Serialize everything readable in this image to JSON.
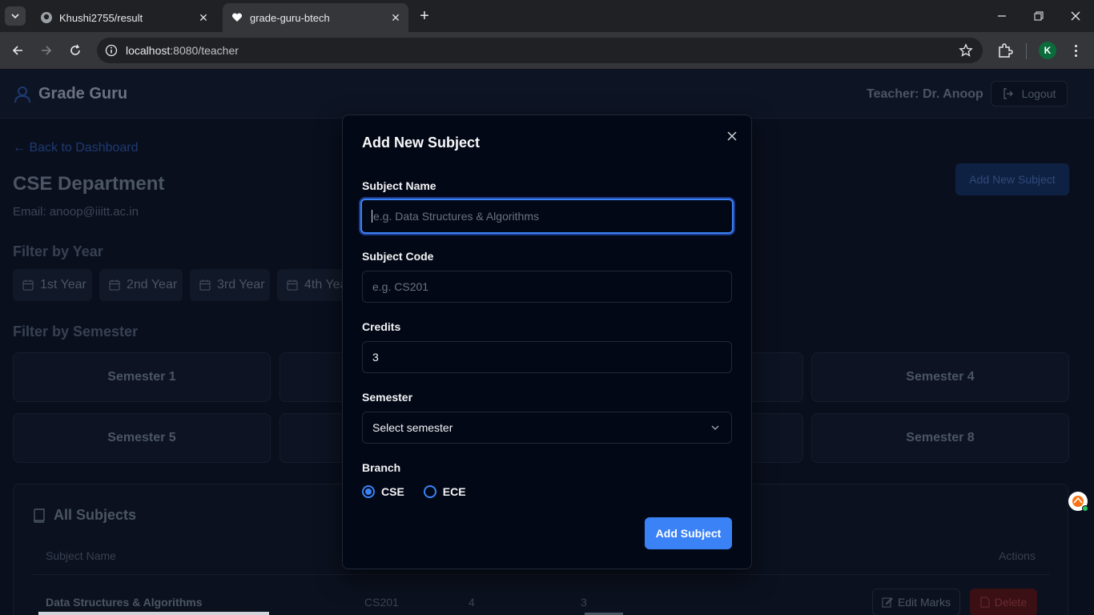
{
  "browser": {
    "tabs": [
      {
        "title": "Khushi2755/result",
        "active": false
      },
      {
        "title": "grade-guru-btech",
        "active": true
      }
    ],
    "url_host": "localhost",
    "url_path": ":8080/teacher",
    "profile_initial": "K"
  },
  "app": {
    "brand": "Grade Guru",
    "teacher_label": "Teacher: Dr. Anoop",
    "logout_label": "Logout",
    "back_link": "← Back to Dashboard",
    "department": "CSE Department",
    "email": "Email: anoop@iiitt.ac.in",
    "add_new_subject_label": "Add New Subject",
    "filter_year_heading": "Filter by Year",
    "years": [
      "1st Year",
      "2nd Year",
      "3rd Year",
      "4th Year"
    ],
    "filter_semester_heading": "Filter by Semester",
    "semesters_visible": [
      "Semester 1",
      "Semester 4",
      "Semester 5",
      "Semester 8"
    ],
    "all_subjects_heading": "All Subjects",
    "table": {
      "headers": {
        "name": "Subject Name",
        "actions": "Actions"
      },
      "rows": [
        {
          "name": "Data Structures & Algorithms",
          "code": "CS201",
          "credits": "4",
          "semester": "3"
        }
      ],
      "edit_label": "Edit Marks",
      "delete_label": "Delete"
    }
  },
  "modal": {
    "title": "Add New Subject",
    "subject_name_label": "Subject Name",
    "subject_name_placeholder": "e.g. Data Structures & Algorithms",
    "subject_code_label": "Subject Code",
    "subject_code_placeholder": "e.g. CS201",
    "credits_label": "Credits",
    "credits_value": "3",
    "semester_label": "Semester",
    "semester_value": "Select semester",
    "branch_label": "Branch",
    "branch_options": [
      {
        "label": "CSE",
        "selected": true
      },
      {
        "label": "ECE",
        "selected": false
      }
    ],
    "submit_label": "Add Subject"
  },
  "colors": {
    "accent": "#3b82f6",
    "modal_bg": "#030816"
  }
}
